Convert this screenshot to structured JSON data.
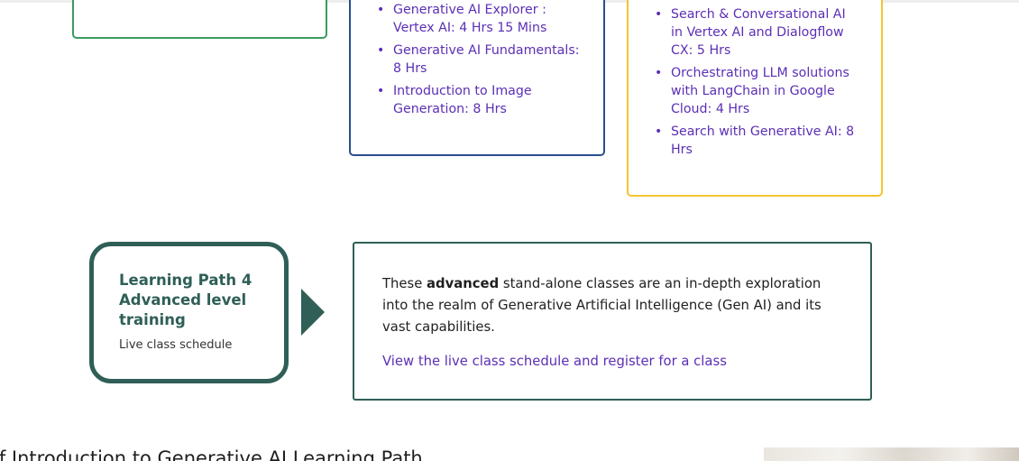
{
  "blue_card": {
    "courses": [
      "Generative AI Explorer : Vertex AI: 4 Hrs 15 Mins",
      "Generative AI Fundamentals: 8 Hrs",
      "Introduction to Image Generation: 8 Hrs"
    ]
  },
  "yellow_card": {
    "courses": [
      "Search & Conversational AI in Vertex AI and Dialogflow CX: 5 Hrs",
      "Orchestrating LLM solutions with LangChain in Google Cloud: 4 Hrs",
      "Search with Generative AI: 8 Hrs"
    ]
  },
  "learning_path": {
    "title": "Learning Path 4 Advanced level training",
    "subtitle": "Live class schedule"
  },
  "info": {
    "text_before": "These ",
    "text_bold": "advanced",
    "text_after": " stand-alone classes are an in-depth exploration into the realm of Generative Artificial Intelligence (Gen AI) and its vast capabilities.",
    "link": "View the live class schedule and register for a class"
  },
  "bottom": {
    "heading": "of Introduction to Generative AI Learning Path"
  },
  "colors": {
    "accent": "#2f5f57",
    "link": "#5b2fb5",
    "green_border": "#3c9a5f",
    "blue_border": "#2b4f8c",
    "yellow_border": "#f4c430"
  }
}
